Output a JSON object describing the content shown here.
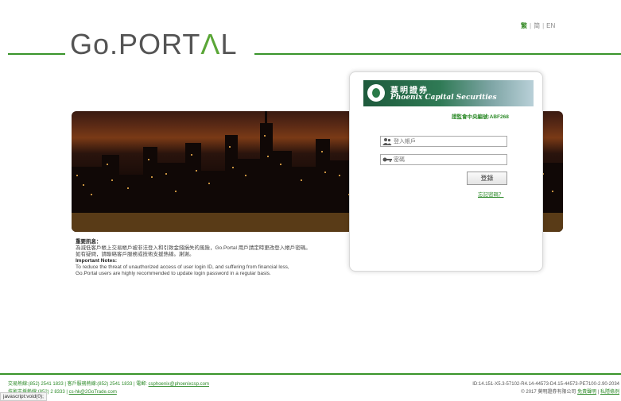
{
  "lang": {
    "trad": "繁",
    "simp": "简",
    "en": "EN",
    "sep": "|"
  },
  "logo": {
    "pre": "Go.PORT",
    "accent": "Λ",
    "post": "L"
  },
  "notes": {
    "heading_cn": "重要訊息：",
    "body_cn1": "為減低客戶帳上交易帳戶被非法登入和引致金錢損失的風險，Go.Portal 用戶請定時更改登入帳戶密碼。",
    "body_cn2": "如有疑問，請聯絡客戶服務或技術支援熱線。謝謝。",
    "heading_en": "Important Notes:",
    "body_en1": "To reduce the threat of unauthorized access of user login ID, and suffering from financial loss,",
    "body_en2": "Go.Portal users are highly recommended to update login password in a regular basis."
  },
  "brand": {
    "cn": "莫明證券",
    "en": "Phoenix Capital Securities"
  },
  "login": {
    "ce_no": "證監會中央編號:ABF268",
    "user_placeholder": "登入帳戶",
    "pass_placeholder": "密碼",
    "login_button": "登錄",
    "forgot": "忘記密碼？"
  },
  "footer": {
    "line1_label": "交易熱線:(852) 2541 1833 | 客戶服務熱線:(852) 2541 1833 | 電郵: ",
    "line1_email": "csphoenix@phoenixcsp.com",
    "line2_text": "技術支援熱線:(852) 2 8333 | ",
    "line2_email": "cs-hk@2GoTrade.com",
    "id_text": "ID:14.151-X5.3-57102-R4.14-44573-D4.15-44573-PE7100-2.90-2034",
    "copyright": "© 2017 莫明證券有限公司 ",
    "disclaimer": "免責聲明",
    "sep": " | ",
    "privacy": "私隱條例"
  },
  "status_bar": "javascript:void(0);",
  "colors": {
    "accent": "#39942a",
    "link": "#2e8b2a",
    "logo": "#545454"
  }
}
